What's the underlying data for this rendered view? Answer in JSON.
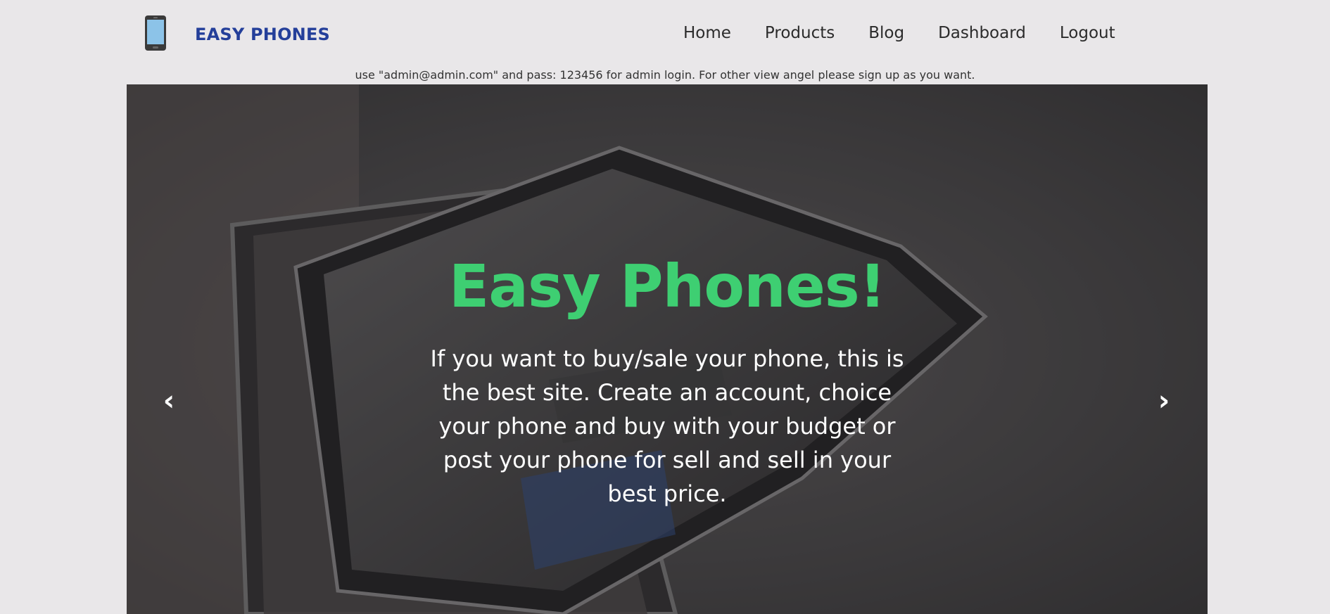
{
  "brand": {
    "name": "EASY PHONES",
    "icon": "phone-icon"
  },
  "nav": {
    "items": [
      {
        "label": "Home"
      },
      {
        "label": "Products"
      },
      {
        "label": "Blog"
      },
      {
        "label": "Dashboard"
      },
      {
        "label": "Logout"
      }
    ]
  },
  "notice": "use \"admin@admin.com\" and pass: 123456 for admin login. For other view angel please sign up as you want.",
  "hero": {
    "title": "Easy Phones!",
    "text": "If you want to buy/sale your phone, this is the best site. Create an account, choice your phone and buy with your budget or post your phone for sell and sell in your best price.",
    "prev_label": "‹",
    "next_label": "›",
    "title_color": "#3ecf72"
  },
  "colors": {
    "brand": "#243f9a",
    "background": "#e9e7e9"
  }
}
